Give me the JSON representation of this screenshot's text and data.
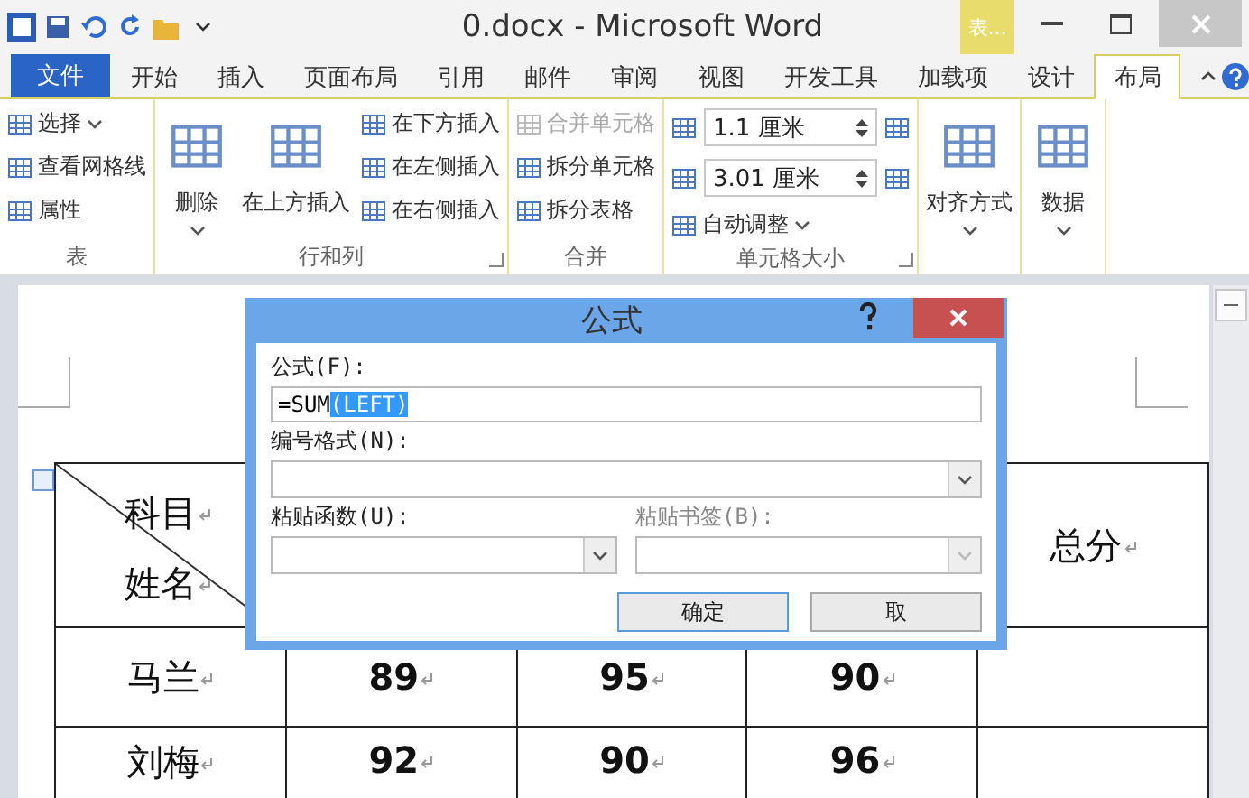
{
  "window": {
    "title": "0.docx - Microsoft Word",
    "context_label": "表..."
  },
  "file_tab": "文件",
  "tabs": [
    {
      "label": "开始",
      "selected": false
    },
    {
      "label": "插入",
      "selected": false
    },
    {
      "label": "页面布局",
      "selected": false
    },
    {
      "label": "引用",
      "selected": false
    },
    {
      "label": "邮件",
      "selected": false
    },
    {
      "label": "审阅",
      "selected": false
    },
    {
      "label": "视图",
      "selected": false
    },
    {
      "label": "开发工具",
      "selected": false
    },
    {
      "label": "加载项",
      "selected": false
    },
    {
      "label": "设计",
      "selected": false
    },
    {
      "label": "布局",
      "selected": true
    }
  ],
  "ribbon": [
    {
      "label": "表",
      "launcher": false,
      "columns": [
        [
          {
            "kind": "small",
            "label": "选择",
            "dropdown": true,
            "disabled": false
          },
          {
            "kind": "small",
            "label": "查看网格线",
            "dropdown": false,
            "disabled": false
          },
          {
            "kind": "small",
            "label": "属性",
            "dropdown": false,
            "disabled": false
          }
        ]
      ]
    },
    {
      "label": "行和列",
      "launcher": true,
      "columns": [
        [
          {
            "kind": "large",
            "label": "删除",
            "dropdown": true,
            "disabled": false
          }
        ],
        [
          {
            "kind": "large",
            "label": "在上方插入",
            "dropdown": false,
            "disabled": false
          }
        ],
        [
          {
            "kind": "small",
            "label": "在下方插入",
            "dropdown": false,
            "disabled": false
          },
          {
            "kind": "small",
            "label": "在左侧插入",
            "dropdown": false,
            "disabled": false
          },
          {
            "kind": "small",
            "label": "在右侧插入",
            "dropdown": false,
            "disabled": false
          }
        ]
      ]
    },
    {
      "label": "合并",
      "launcher": false,
      "columns": [
        [
          {
            "kind": "small",
            "label": "合并单元格",
            "dropdown": false,
            "disabled": true
          },
          {
            "kind": "small",
            "label": "拆分单元格",
            "dropdown": false,
            "disabled": false
          },
          {
            "kind": "small",
            "label": "拆分表格",
            "dropdown": false,
            "disabled": false
          }
        ]
      ]
    },
    {
      "label": "单元格大小",
      "launcher": true,
      "columns": [
        [
          {
            "kind": "spin",
            "label": "1.1 厘米",
            "disabled": false
          },
          {
            "kind": "spin",
            "label": "3.01 厘米",
            "disabled": false
          },
          {
            "kind": "small",
            "label": "自动调整",
            "dropdown": true,
            "disabled": false
          }
        ]
      ]
    },
    {
      "launcher": false,
      "columns": [
        [
          {
            "kind": "large",
            "label": "对齐方式",
            "dropdown": true,
            "disabled": false
          }
        ]
      ]
    },
    {
      "launcher": false,
      "columns": [
        [
          {
            "kind": "large",
            "label": "数据",
            "dropdown": true,
            "disabled": false
          }
        ]
      ]
    }
  ],
  "table": {
    "header": {
      "top": "科目",
      "bottom": "姓名",
      "last": "总分"
    },
    "rows": [
      {
        "cells": [
          "马兰",
          "89",
          "95",
          "90",
          ""
        ]
      },
      {
        "cells": [
          "刘梅",
          "92",
          "90",
          "96",
          ""
        ]
      }
    ]
  },
  "dialog": {
    "title": "公式",
    "formula_label": "公式(F):",
    "formula_plain": "=SUM",
    "formula_selected": "(LEFT)",
    "format_label": "编号格式(N):",
    "function_label": "粘贴函数(U):",
    "bookmark_label": "粘贴书签(B):",
    "bookmark_disabled": true,
    "ok": "确定",
    "cancel": "取"
  }
}
